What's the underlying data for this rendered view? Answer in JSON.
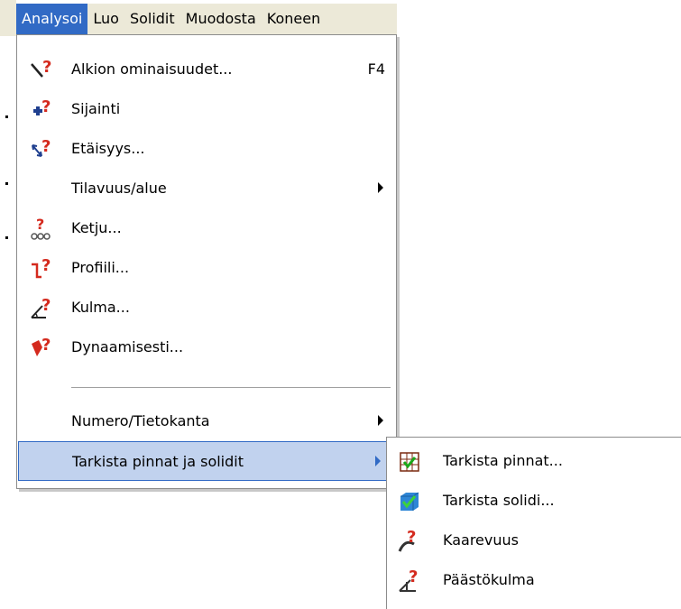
{
  "menubar": {
    "items": [
      {
        "label": "Analysoi"
      },
      {
        "label": "Luo"
      },
      {
        "label": "Solidit"
      },
      {
        "label": "Muodosta"
      },
      {
        "label": "Koneen"
      }
    ]
  },
  "analysoi_menu": {
    "items": [
      {
        "label": "Alkion ominaisuudet...",
        "shortcut": "F4",
        "icon": "entity-properties-icon"
      },
      {
        "label": "Sijainti",
        "icon": "position-icon"
      },
      {
        "label": "Etäisyys...",
        "icon": "distance-icon"
      },
      {
        "label": "Tilavuus/alue",
        "icon": "none",
        "submenu": true
      },
      {
        "label": "Ketju...",
        "icon": "chain-icon"
      },
      {
        "label": "Profiili...",
        "icon": "profile-icon"
      },
      {
        "label": "Kulma...",
        "icon": "angle-icon"
      },
      {
        "label": "Dynaamisesti...",
        "icon": "dynamic-icon"
      },
      {
        "label": "Numero/Tietokanta",
        "icon": "none",
        "submenu": true
      },
      {
        "label": "Tarkista pinnat ja solidit",
        "icon": "none",
        "submenu": true,
        "highlighted": true
      }
    ]
  },
  "check_submenu": {
    "items": [
      {
        "label": "Tarkista pinnat...",
        "icon": "check-surfaces-icon"
      },
      {
        "label": "Tarkista solidi...",
        "icon": "check-solid-icon"
      },
      {
        "label": "Kaarevuus",
        "icon": "curvature-icon"
      },
      {
        "label": "Päästökulma",
        "icon": "draft-angle-icon"
      }
    ]
  },
  "colors": {
    "menu_highlight": "#316ac5",
    "item_highlight_bg": "#c1d2ee",
    "menubar_bg": "#ece9d8",
    "icon_red": "#d42a1e"
  }
}
